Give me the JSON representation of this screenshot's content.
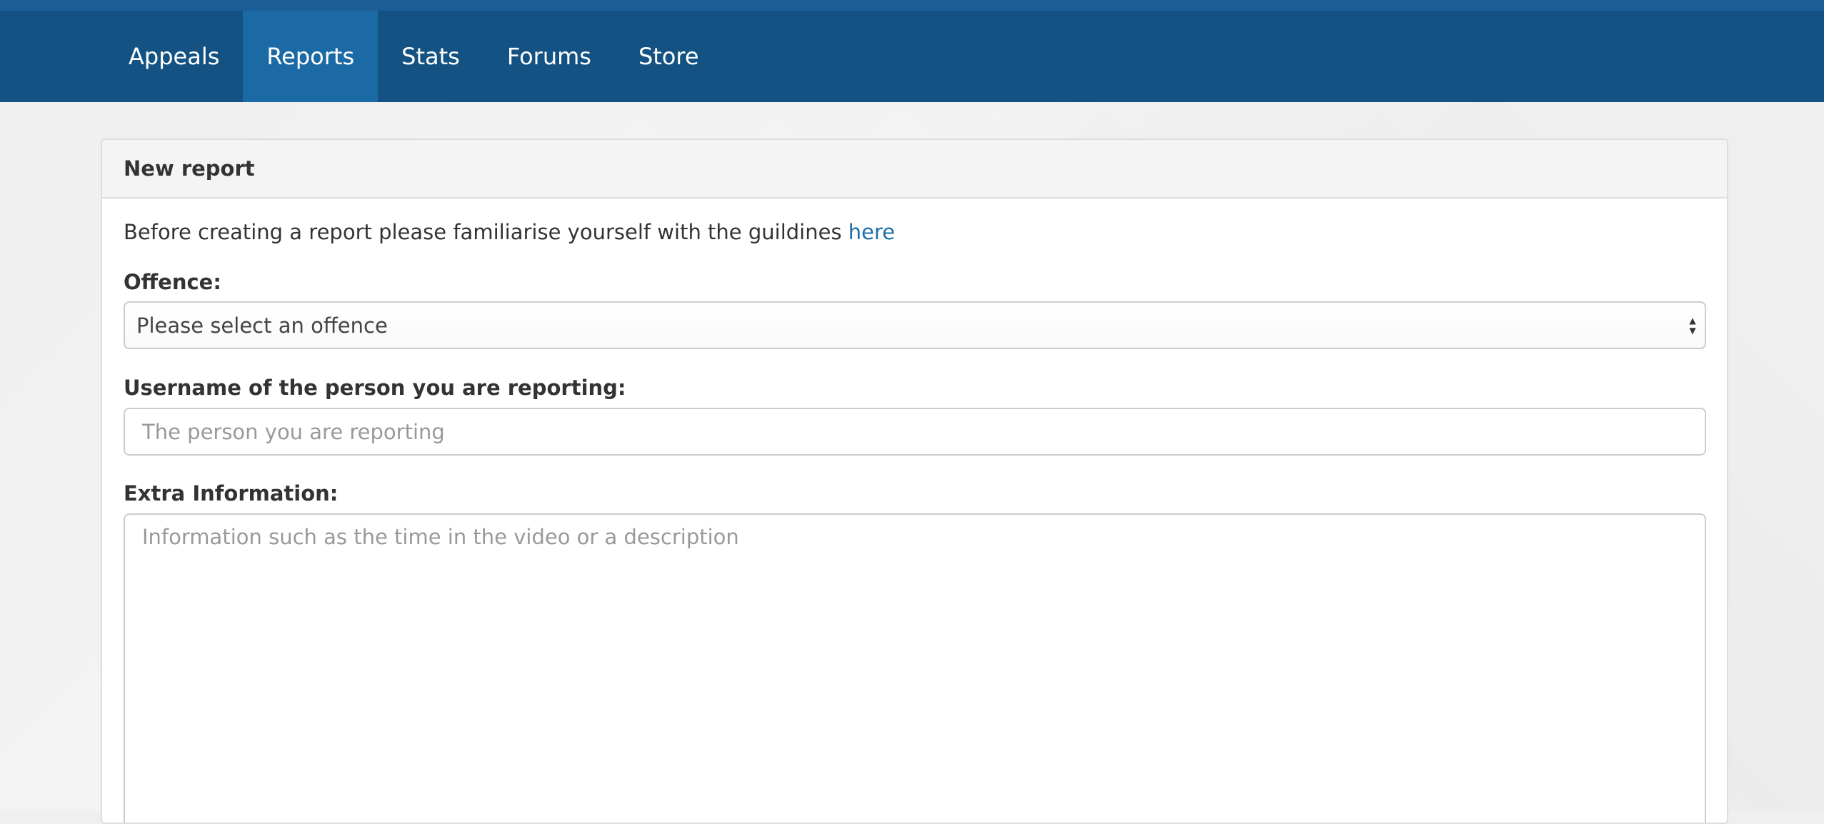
{
  "nav": {
    "items": [
      {
        "label": "Appeals",
        "active": false
      },
      {
        "label": "Reports",
        "active": true
      },
      {
        "label": "Stats",
        "active": false
      },
      {
        "label": "Forums",
        "active": false
      },
      {
        "label": "Store",
        "active": false
      }
    ]
  },
  "panel": {
    "title": "New report",
    "intro_text": "Before creating a report please familiarise yourself with the guildines ",
    "intro_link": "here"
  },
  "form": {
    "offence": {
      "label": "Offence:",
      "selected": "Please select an offence"
    },
    "username": {
      "label": "Username of the person you are reporting:",
      "placeholder": "The person you are reporting",
      "value": ""
    },
    "extra": {
      "label": "Extra Information:",
      "placeholder": "Information such as the time in the video or a description",
      "value": ""
    }
  },
  "colors": {
    "nav_bg": "#135283",
    "nav_active": "#1b6aa5",
    "link": "#1d6fa8"
  }
}
